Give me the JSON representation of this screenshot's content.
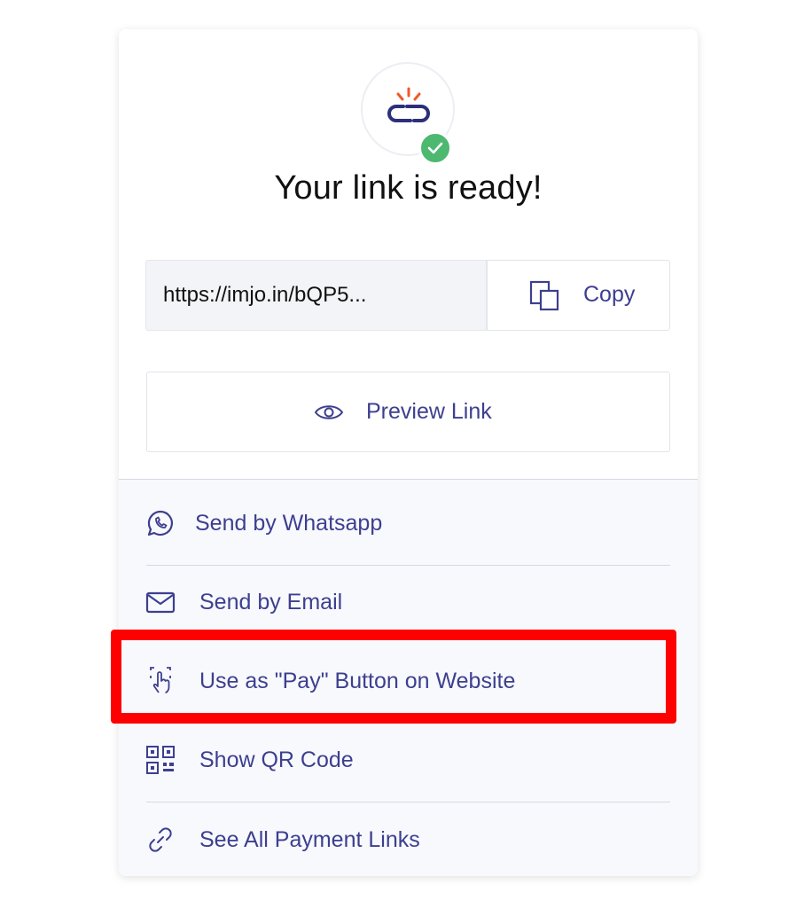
{
  "header": {
    "title": "Your link is ready!",
    "logo_icon": "broken-chain-link-icon",
    "badge_icon": "check-icon",
    "badge_color": "#4db870"
  },
  "link": {
    "url": "https://imjo.in/bQP5...",
    "copy_label": "Copy",
    "copy_icon": "copy-icon"
  },
  "preview": {
    "label": "Preview Link",
    "icon": "eye-icon"
  },
  "share_options": [
    {
      "label": "Send by Whatsapp",
      "icon": "whatsapp-icon"
    },
    {
      "label": "Send by Email",
      "icon": "envelope-icon"
    },
    {
      "label": "Use as \"Pay\" Button on Website",
      "icon": "hand-tap-icon"
    },
    {
      "label": "Show QR Code",
      "icon": "qr-code-icon"
    },
    {
      "label": "See All Payment Links",
      "icon": "link-icon"
    }
  ],
  "colors": {
    "accent_text": "#3d3f8f",
    "highlight": "#ff0000",
    "logo_orange": "#f0592a"
  }
}
